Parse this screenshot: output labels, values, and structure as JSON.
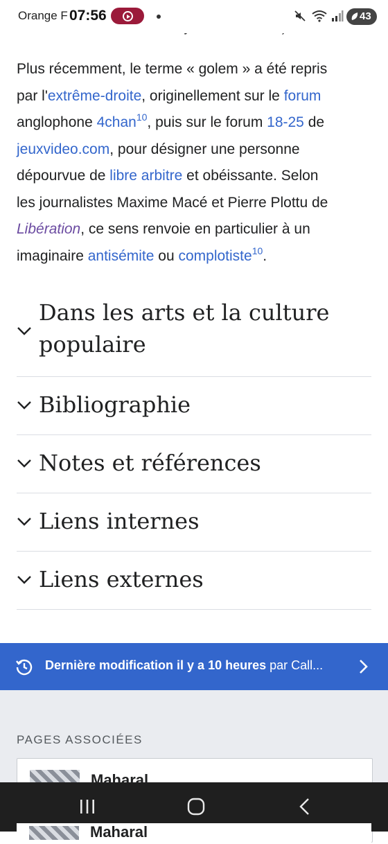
{
  "status_bar": {
    "carrier": "Orange F",
    "time": "07:56",
    "battery": "43"
  },
  "article": {
    "cut_line": "dessinées, romans, films, jeux vidéo, etc.).",
    "paragraph": {
      "l1": "Plus récemment, le terme « golem » a été repris",
      "l2_a": "par l'",
      "l2_link1": "extrême-droite",
      "l2_b": ", originellement sur le ",
      "l2_link2": "forum",
      "l3_a": "anglophone ",
      "l3_link1": "4chan",
      "l3_sup": "10",
      "l3_b": ", puis sur le forum ",
      "l3_link2": "18-25",
      "l3_c": " de",
      "l4_link": "jeuxvideo.com",
      "l4_b": ", pour désigner une personne",
      "l5_a": "dépourvue de ",
      "l5_link": "libre arbitre",
      "l5_b": " et obéissante. Selon",
      "l6": "les journalistes Maxime Macé et Pierre Plottu de",
      "l7_ital": "Libération",
      "l7_b": ", ce sens renvoie en particulier à un",
      "l8_a": "imaginaire ",
      "l8_link1": "antisémite",
      "l8_b": " ou ",
      "l8_link2": "complotiste",
      "l8_sup": "10",
      "l8_c": "."
    }
  },
  "sections": {
    "s1_line1": "Dans les arts et la culture",
    "s1_line2": "populaire",
    "s2": "Bibliographie",
    "s3": "Notes et références",
    "s4": "Liens internes",
    "s5": "Liens externes"
  },
  "last_modified": {
    "bold_text": "Dernière modification il y a 10 heures",
    "by_text": " par Call..."
  },
  "related": {
    "heading": "PAGES ASSOCIÉES",
    "card1_title": "Maharal",
    "card2_title": "Maharal"
  },
  "colors": {
    "link": "#3366cc",
    "lastmod_bg": "#3366cc",
    "footer_bg": "#eaecf0",
    "navbar_bg": "#1f1f1f"
  }
}
